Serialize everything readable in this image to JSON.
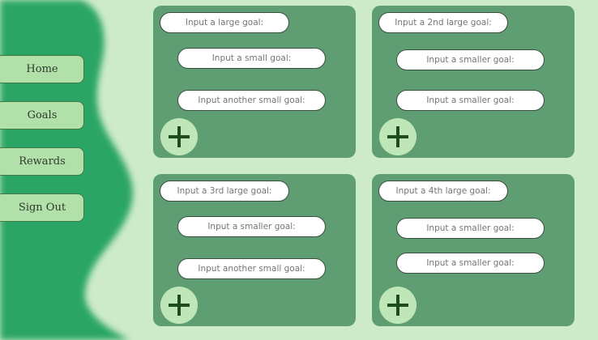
{
  "nav": {
    "items": [
      {
        "label": "Home"
      },
      {
        "label": "Goals"
      },
      {
        "label": "Rewards"
      },
      {
        "label": "Sign Out"
      }
    ]
  },
  "cards": [
    {
      "large_placeholder": "Input a large goal:",
      "small_placeholders": [
        "Input a small goal:",
        "Input another small goal:"
      ]
    },
    {
      "large_placeholder": "Input a 2nd large goal:",
      "small_placeholders": [
        "Input a smaller goal:",
        "Input a smaller goal:"
      ]
    },
    {
      "large_placeholder": "Input a 3rd large goal:",
      "small_placeholders": [
        "Input a smaller goal:",
        "Input another small goal:"
      ]
    },
    {
      "large_placeholder": "Input a 4th large goal:",
      "small_placeholders": [
        "Input a smaller goal:",
        "Input a smaller goal:"
      ]
    }
  ],
  "add_icon": "plus-icon",
  "colors": {
    "background": "#cdebc9",
    "wave": "#2aa565",
    "card": "#5f9e72",
    "nav_button": "#b1e1a8",
    "add_button": "#bfe6b7",
    "plus": "#1d4d1f"
  }
}
